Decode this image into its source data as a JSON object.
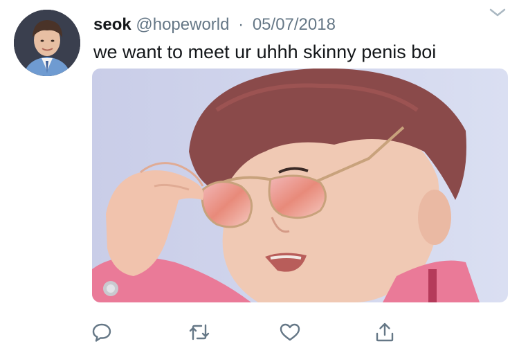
{
  "tweet": {
    "display_name": "seok",
    "handle": "@hopeworld",
    "separator": "·",
    "date": "05/07/2018",
    "text": "we want to meet ur uhhh skinny penis boi"
  },
  "icons": {
    "more": "chevron-down-icon",
    "reply": "reply-bubble-icon",
    "retweet": "retweet-arrows-icon",
    "like": "heart-icon",
    "share": "share-upload-icon"
  },
  "colors": {
    "text_primary": "#14171a",
    "text_secondary": "#657786",
    "icon_gray": "#657786",
    "media_background": "#d4d9ef",
    "jacket_pink": "#ea7a98"
  }
}
